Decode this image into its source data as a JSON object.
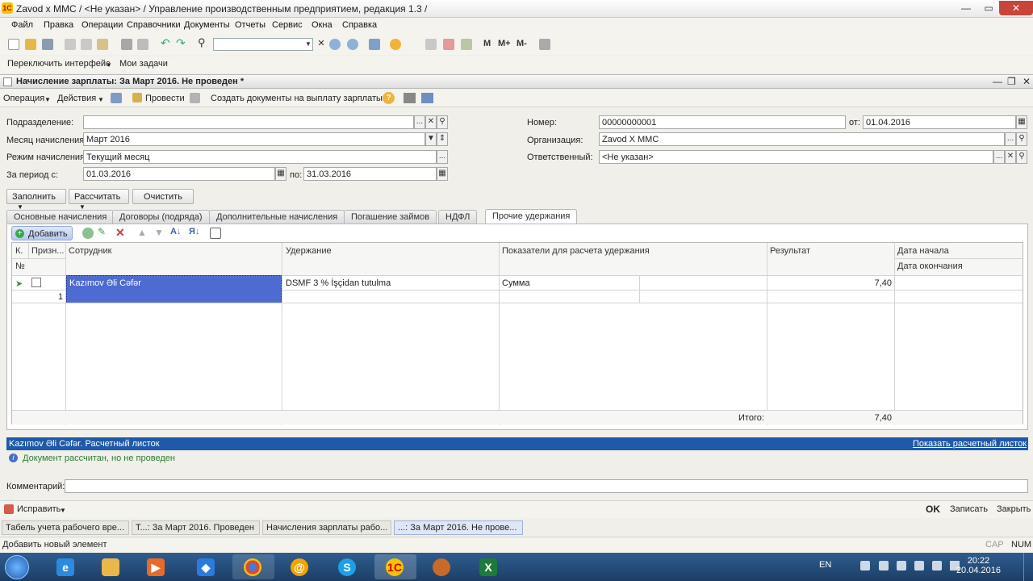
{
  "window": {
    "title": "Zavod x MMC / <Не указан> / Управление производственным предприятием, редакция 1.3 /"
  },
  "menu": [
    "Файл",
    "Правка",
    "Операции",
    "Справочники",
    "Документы",
    "Отчеты",
    "Сервис",
    "Окна",
    "Справка"
  ],
  "toolbar2": {
    "switch_interface": "Переключить интерфейс",
    "my_tasks": "Мои задачи",
    "m": "M",
    "m_plus": "M+",
    "m_minus": "M-"
  },
  "document": {
    "title": "Начисление зарплаты: За Март 2016. Не проведен *",
    "toolbar": {
      "operation": "Операция",
      "actions": "Действия",
      "post": "Провести",
      "create_payment_docs": "Создать документы на выплату зарплаты"
    },
    "fields": {
      "department_label": "Подразделение:",
      "department_value": "",
      "month_label": "Месяц начисления:",
      "month_value": "Март 2016",
      "mode_label": "Режим начисления:",
      "mode_value": "Текущий месяц",
      "period_label": "За период с:",
      "period_from": "01.03.2016",
      "period_to_label": "по:",
      "period_to": "31.03.2016",
      "number_label": "Номер:",
      "number_value": "00000000001",
      "date_label": "от:",
      "date_value": "01.04.2016",
      "org_label": "Организация:",
      "org_value": "Zavod  X MMC",
      "responsible_label": "Ответственный:",
      "responsible_value": "<Не указан>"
    },
    "buttons": {
      "fill": "Заполнить",
      "calculate": "Рассчитать",
      "clear": "Очистить"
    },
    "tabs": [
      "Основные начисления",
      "Договоры (подряда)",
      "Дополнительные начисления",
      "Погашение займов",
      "НДФЛ",
      "Прочие удержания"
    ],
    "grid_toolbar": {
      "add": "Добавить"
    },
    "grid": {
      "headers": {
        "k": "К.",
        "sign": "Призн...",
        "num": "№",
        "employee": "Сотрудник",
        "deduction": "Удержание",
        "indicators": "Показатели для расчета удержания",
        "result": "Результат",
        "start_date": "Дата начала",
        "end_date": "Дата окончания"
      },
      "rows": [
        {
          "num": "1",
          "employee": "Kazımov Əli Cəfər",
          "deduction": "DSMF 3 % İşçidan tutulma",
          "indicator": "Сумма",
          "result": "7,40"
        }
      ],
      "total_label": "Итого:",
      "total_value": "7,40"
    },
    "payslip_bar": {
      "left": "Kazımov Əli Cəfər. Расчетный листок",
      "right": "Показать расчетный листок"
    },
    "info_message": "Документ рассчитан, но не проведен",
    "comment_label": "Комментарий:",
    "comment_value": "",
    "bottom": {
      "fix": "Исправить",
      "ok": "OK",
      "save": "Записать",
      "close": "Закрыть"
    }
  },
  "open_windows": [
    "Табель учета рабочего вре...",
    "Т...: За Март 2016. Проведен",
    "Начисления зарплаты рабо...",
    "...: За Март 2016. Не прове..."
  ],
  "status_text": "Добавить новый элемент",
  "status_indicators": [
    "CAP",
    "NUM"
  ],
  "os": {
    "lang": "EN",
    "time": "20:22",
    "date": "20.04.2016"
  },
  "colors": {
    "selection": "#4d6bd0",
    "payslip_bar": "#1e5aa8",
    "taskbar": "#1c3e66"
  }
}
